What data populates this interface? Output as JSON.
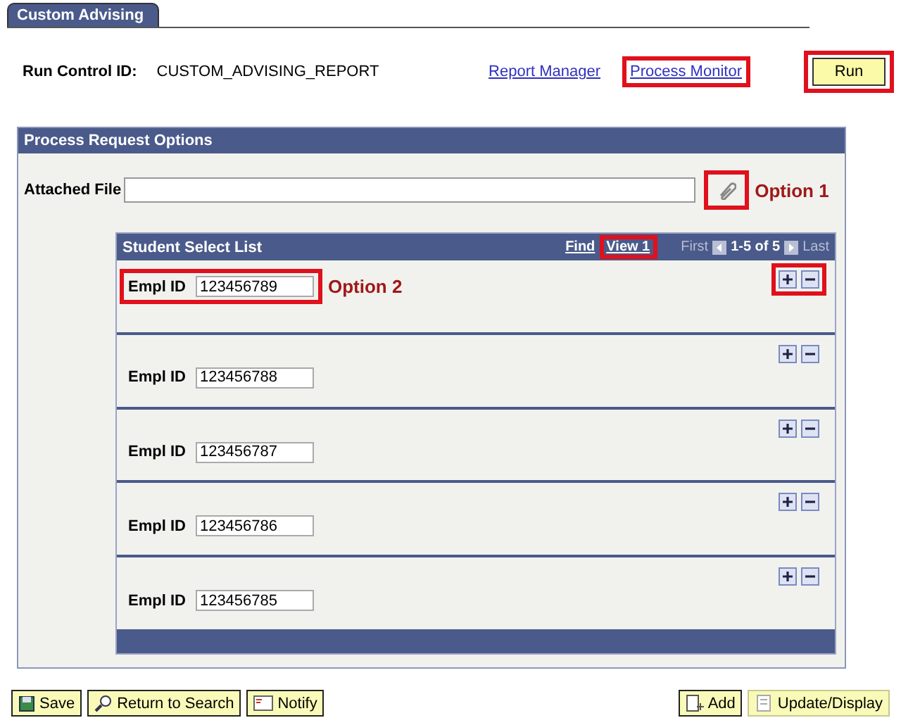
{
  "tabs": [
    {
      "label": "Custom Advising",
      "selected": true
    }
  ],
  "run_control": {
    "label": "Run Control ID:",
    "value": "CUSTOM_ADVISING_REPORT"
  },
  "links": [
    {
      "label": "Report Manager",
      "highlighted": false
    },
    {
      "label": "Process Monitor",
      "highlighted": true
    }
  ],
  "run_button": {
    "label": "Run",
    "highlighted": true
  },
  "panel": {
    "title": "Process Request Options",
    "attached_file": {
      "label": "Attached File",
      "attach_highlighted": true,
      "note": "Option 1"
    },
    "grid": {
      "title": "Student Select List",
      "find": "Find",
      "view": {
        "label": "View 1",
        "highlighted": true
      },
      "first": "First",
      "range": "1-5 of 5",
      "last": "Last",
      "rows": [
        {
          "label": "Empl ID",
          "value": "123456789",
          "highlighted": true,
          "note": "Option 2",
          "actions_highlighted": true
        },
        {
          "label": "Empl ID",
          "value": "123456788",
          "highlighted": false,
          "actions_highlighted": false
        },
        {
          "label": "Empl ID",
          "value": "123456787",
          "highlighted": false,
          "actions_highlighted": false
        },
        {
          "label": "Empl ID",
          "value": "123456786",
          "highlighted": false,
          "actions_highlighted": false
        },
        {
          "label": "Empl ID",
          "value": "123456785",
          "highlighted": false,
          "actions_highlighted": false
        }
      ]
    }
  },
  "toolbar": {
    "left": [
      {
        "label": "Save",
        "kind": "save",
        "disabled": false
      },
      {
        "label": "Return to Search",
        "kind": "search",
        "disabled": false
      },
      {
        "label": "Notify",
        "kind": "notify",
        "disabled": false
      }
    ],
    "right": [
      {
        "label": "Add",
        "kind": "add",
        "disabled": false
      },
      {
        "label": "Update/Display",
        "kind": "update",
        "disabled": true
      }
    ]
  }
}
